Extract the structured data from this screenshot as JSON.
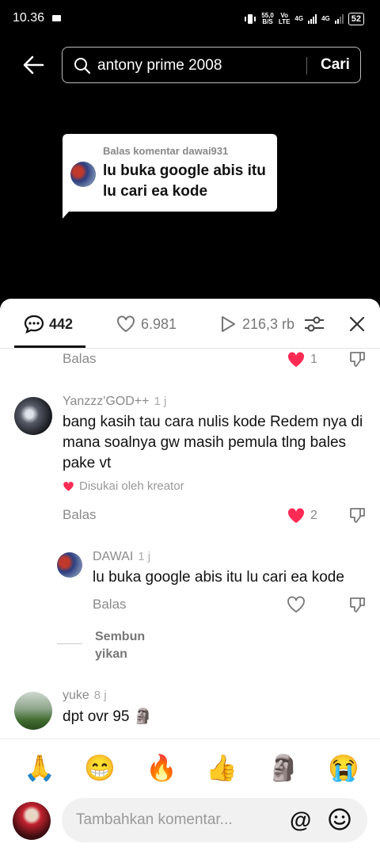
{
  "status_bar": {
    "time": "10.36",
    "net_speed_top": "55,0",
    "net_speed_bottom": "B/S",
    "volte_top": "Vo",
    "volte_bottom": "LTE",
    "sig1": "4G",
    "sig2": "4G",
    "battery": "52"
  },
  "search": {
    "query": "antony prime 2008",
    "button": "Cari"
  },
  "reply_card": {
    "header": "Balas komentar dawai931",
    "text": "lu buka google abis itu lu cari ea kode"
  },
  "tabs": {
    "comments_count": "442",
    "likes_count": "6.981",
    "views_count": "216,3 rb"
  },
  "comments": {
    "prev": {
      "reply_label": "Balas",
      "likes": "1"
    },
    "c1": {
      "user": "Yanzzz'GOD++",
      "time": "1 j",
      "text": "bang kasih tau cara nulis kode Redem nya di mana soalnya gw masih pemula tlng bales pake vt",
      "creator_liked": "Disukai oleh kreator",
      "reply_label": "Balas",
      "likes": "2"
    },
    "r1": {
      "user": "DAWAI",
      "time": "1 j",
      "text": "lu buka google abis itu lu cari ea kode",
      "reply_label": "Balas"
    },
    "collapse_line1": "Sembun",
    "collapse_line2": "yikan",
    "c2": {
      "user": "yuke",
      "time": "8 j",
      "text": "dpt ovr 95 🗿"
    }
  },
  "emoji_bar": [
    "🙏",
    "😁",
    "🔥",
    "👍",
    "🗿",
    "😭"
  ],
  "composer": {
    "placeholder": "Tambahkan komentar...",
    "at_symbol": "@"
  },
  "colors": {
    "like_red": "#fe2c55",
    "muted": "#8a8a8a"
  }
}
